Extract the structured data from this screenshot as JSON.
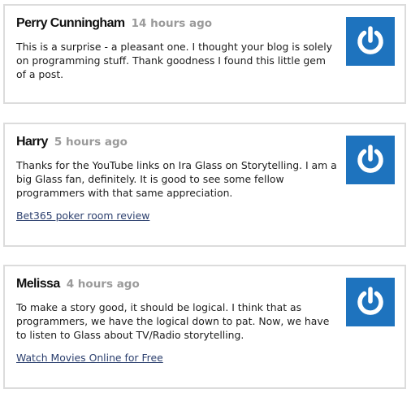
{
  "comments": [
    {
      "author": "Perry Cunningham",
      "time": "14 hours ago",
      "text": "This is a surprise - a pleasant one. I thought your blog is solely on programming stuff. Thank goodness I found this little gem of a post.",
      "link": "",
      "avatar_icon": "power-icon"
    },
    {
      "author": "Harry",
      "time": "5 hours ago",
      "text": "Thanks for the YouTube links on Ira Glass on Storytelling. I am a big Glass fan, definitely. It is good to see some fellow programmers with that same appreciation.",
      "link": "Bet365 poker room review",
      "avatar_icon": "power-icon"
    },
    {
      "author": "Melissa",
      "time": "4 hours ago",
      "text": "To make a story good, it should be logical. I think that as programmers, we have the logical down to pat. Now, we have to listen to Glass about TV/Radio storytelling.",
      "link": "Watch Movies Online for Free",
      "avatar_icon": "power-icon"
    }
  ],
  "colors": {
    "avatar_bg": "#1e73be",
    "link": "#2b3f6e",
    "timestamp": "#9a9a9a",
    "border": "#dcdcdc"
  }
}
